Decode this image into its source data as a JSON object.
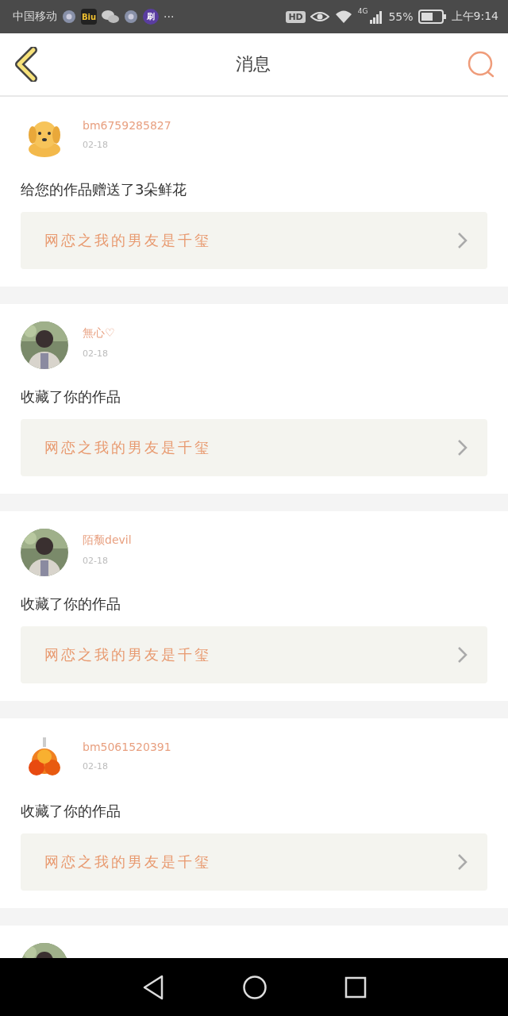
{
  "status_bar": {
    "carrier": "中国移动",
    "app_icons": [
      {
        "kind": "gear"
      },
      {
        "kind": "app",
        "label": "Biu"
      },
      {
        "kind": "chat"
      },
      {
        "kind": "gear"
      },
      {
        "kind": "app",
        "label": "刷"
      }
    ],
    "more": "···",
    "hd": "HD",
    "network": "4G",
    "battery": "55%",
    "time": "上午9:14"
  },
  "header": {
    "title": "消息"
  },
  "messages": [
    {
      "avatar": {
        "kind": "dog"
      },
      "name": "bm6759285827",
      "date": "02-18",
      "text": "给您的作品赠送了3朵鲜花",
      "work": "网恋之我的男友是千玺"
    },
    {
      "name": "無心♡",
      "date": "02-18",
      "text": "收藏了你的作品",
      "work": "网恋之我的男友是千玺"
    },
    {
      "name": "陌颓devil",
      "date": "02-18",
      "text": "收藏了你的作品",
      "work": "网恋之我的男友是千玺"
    },
    {
      "avatar": {
        "kind": "flower"
      },
      "name": "bm5061520391",
      "date": "02-18",
      "text": "收藏了你的作品",
      "work": "网恋之我的男友是千玺"
    }
  ]
}
